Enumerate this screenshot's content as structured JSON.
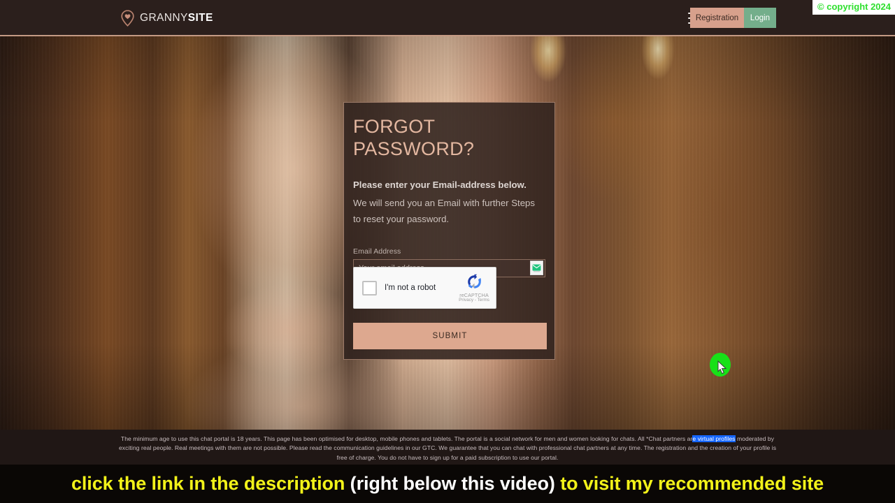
{
  "header": {
    "logo": {
      "icon": "location-pin-heart-icon",
      "text_light": "GRANNY",
      "text_bold": "SITE"
    },
    "menu_icon": "hamburger-menu-icon",
    "registration_label": "Registration",
    "login_label": "Login",
    "registration_color": "#d7a08c",
    "login_color": "#74ae8b"
  },
  "overlay": {
    "copyright_text": "© copyright 2024",
    "copyright_color": "#2ee02e"
  },
  "card": {
    "title": "FORGOT PASSWORD?",
    "lead": "Please enter your Email-address below.",
    "sub_line1": "We will send you an Email with further Steps",
    "sub_line2": "to reset your password.",
    "email_label": "Email Address",
    "email_placeholder": "Your email address",
    "email_value": "",
    "autofill_icon": "email-envelope-icon",
    "submit_label": "SUBMIT",
    "submit_color": "#dda88f",
    "accent_color": "#e3b7a0"
  },
  "recaptcha": {
    "checkbox_state": "unchecked",
    "label": "I'm not a robot",
    "brand": "reCAPTCHA",
    "terms": "Privacy - Terms",
    "logo_icon": "recaptcha-logo-icon"
  },
  "footer": {
    "line1_a": "The minimum age to use this chat portal is 18 years. This page has been optimised for desktop, mobile phones and tablets. The portal is a social network for men and women looking for chats. All *Chat partners ar",
    "selected": "e virtual profiles",
    "line1_b": " moderated by exciting",
    "line2": "real people. Real meetings with them are not possible. Please read the communication guidelines in our GTC. We guarantee that you can chat with professional chat partners at any time. The registration and the creation of your profile is free of charge.",
    "line3": "You do not have to sign up for a paid subscription to use our portal.",
    "selection_color": "#1566ff"
  },
  "subtitle": {
    "part1": "click the link in the description",
    "part2": "(right below this video)",
    "part3": "to visit my recommended site",
    "highlight_color": "#f2f219"
  },
  "cursor": {
    "click_indicator": "green-click-highlight",
    "pointer": "mouse-cursor-arrow"
  }
}
